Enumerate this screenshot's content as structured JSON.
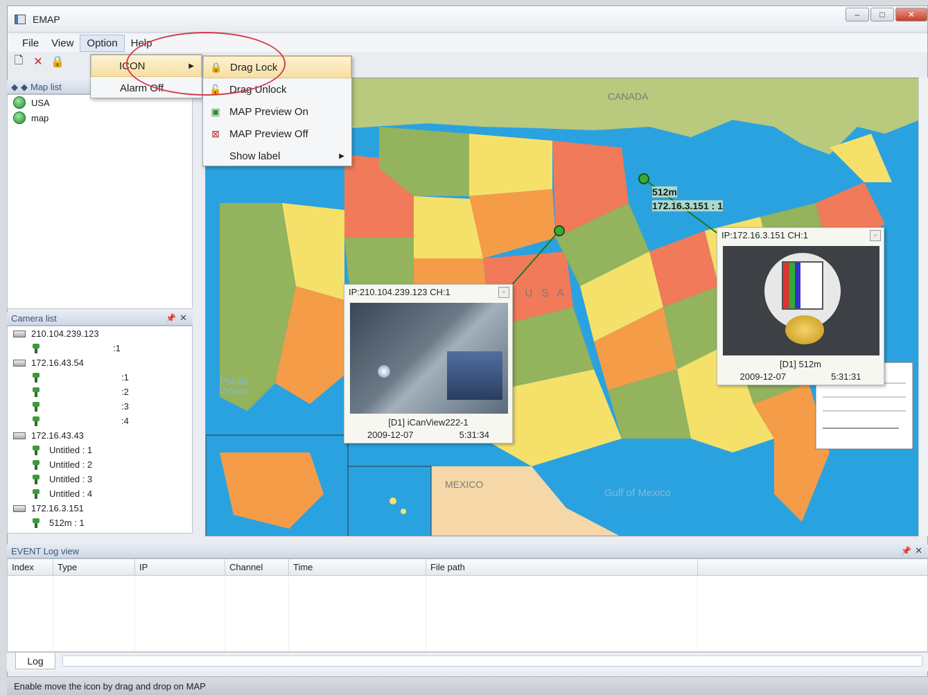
{
  "window": {
    "title": "EMAP",
    "minimize": "–",
    "maximize": "□",
    "close": "✕"
  },
  "menu": {
    "file": "File",
    "view": "View",
    "option": "Option",
    "help": "Help"
  },
  "option_menu": {
    "icon": "ICON",
    "alarm_off": "Alarm Off"
  },
  "icon_submenu": [
    {
      "label": "Drag Lock",
      "icon": "lock-icon",
      "highlighted": true
    },
    {
      "label": "Drag Unlock",
      "icon": "unlock-icon"
    },
    {
      "label": "MAP Preview On",
      "icon": "map-preview-on-icon"
    },
    {
      "label": "MAP Preview Off",
      "icon": "map-preview-off-icon"
    },
    {
      "label": "Show label",
      "icon": "",
      "submenu": true
    }
  ],
  "map_list": {
    "title": "Map list",
    "items": [
      "USA",
      "map"
    ]
  },
  "camera_list": {
    "title": "Camera list",
    "devices": [
      {
        "ip": "210.104.239.123",
        "channels": [
          ":1"
        ]
      },
      {
        "ip": "172.16.43.54",
        "channels": [
          ":1",
          ":2",
          ":3",
          ":4"
        ]
      },
      {
        "ip": "172.16.43.43",
        "channels": [
          "Untitled : 1",
          "Untitled : 2",
          "Untitled : 3",
          "Untitled : 4"
        ]
      },
      {
        "ip": "172.16.3.151",
        "channels": [
          "512m : 1"
        ]
      }
    ]
  },
  "map": {
    "labels": [
      "CANADA",
      "U S A",
      "Pacific Ocean",
      "MEXICO",
      "Gulf of Mexico"
    ],
    "marker_label_1": "512m",
    "marker_label_2": "172.16.3.151 : 1"
  },
  "popups": [
    {
      "title": "IP:210.104.239.123 CH:1",
      "info": "[D1]  iCanView222-1",
      "date": "2009-12-07",
      "time": "5:31:34"
    },
    {
      "title": "IP:172.16.3.151 CH:1",
      "info": "[D1]  512m",
      "date": "2009-12-07",
      "time": "5:31:31"
    }
  ],
  "event_log": {
    "title": "EVENT Log view",
    "columns": [
      "Index",
      "Type",
      "IP",
      "Channel",
      "Time",
      "File path"
    ]
  },
  "log_tab": "Log",
  "status_bar": "Enable move the icon by drag and drop on MAP",
  "colors": {
    "highlight": "#f7dfa3",
    "annotation": "#d33c4a",
    "ocean": "#2aa2df"
  }
}
